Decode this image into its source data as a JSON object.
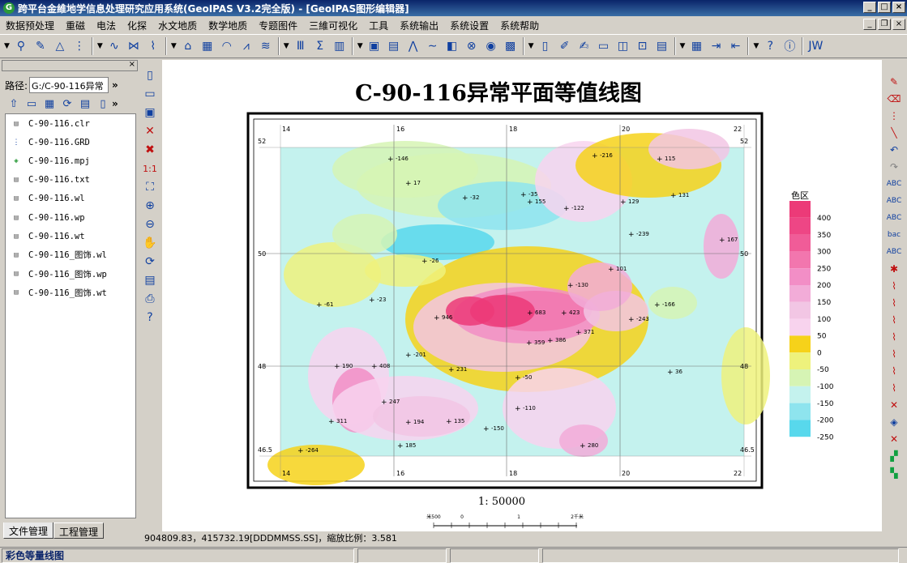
{
  "window": {
    "title": "跨平台金維地学信息处理研究应用系统(GeoIPAS V3.2完全版) - [GeoIPAS图形编辑器]"
  },
  "menu": [
    "数据预处理",
    "重磁",
    "电法",
    "化探",
    "水文地质",
    "数学地质",
    "专题图件",
    "三維可视化",
    "工具",
    "系统输出",
    "系统设置",
    "系统帮助"
  ],
  "left_panel": {
    "path_label": "路径:",
    "path_value": "G:/C-90-116异常",
    "files": [
      {
        "name": "C-90-116.clr",
        "icon": "doc-icon"
      },
      {
        "name": "C-90-116.GRD",
        "icon": "grid-icon"
      },
      {
        "name": "C-90-116.mpj",
        "icon": "layers-icon"
      },
      {
        "name": "C-90-116.txt",
        "icon": "doc-icon"
      },
      {
        "name": "C-90-116.wl",
        "icon": "doc-icon"
      },
      {
        "name": "C-90-116.wp",
        "icon": "doc-icon"
      },
      {
        "name": "C-90-116.wt",
        "icon": "doc-icon"
      },
      {
        "name": "C-90-116_图饰.wl",
        "icon": "doc-icon"
      },
      {
        "name": "C-90-116_图饰.wp",
        "icon": "doc-icon"
      },
      {
        "name": "C-90-116_图饰.wt",
        "icon": "doc-icon"
      }
    ],
    "tabs": [
      "文件管理",
      "工程管理"
    ]
  },
  "map": {
    "title": "C-90-116异常平面等值线图",
    "scale": "1: 50000",
    "scalebar_labels": [
      "米500",
      "0",
      "1",
      "2千米"
    ],
    "legend_title": "色区",
    "legend": [
      {
        "label": "400",
        "color": "#ec3a78"
      },
      {
        "label": "350",
        "color": "#ee4685"
      },
      {
        "label": "300",
        "color": "#f05c98"
      },
      {
        "label": "250",
        "color": "#f276ae"
      },
      {
        "label": "200",
        "color": "#f28ec6"
      },
      {
        "label": "150",
        "color": "#f2acd8"
      },
      {
        "label": "100",
        "color": "#f2c6e4"
      },
      {
        "label": "50",
        "color": "#f8d3ee"
      },
      {
        "label": "0",
        "color": "#f6d21a"
      },
      {
        "label": "-50",
        "color": "#eef27c"
      },
      {
        "label": "-100",
        "color": "#d6f4b4"
      },
      {
        "label": "-150",
        "color": "#c4f2ee"
      },
      {
        "label": "-200",
        "color": "#8ee4ee"
      },
      {
        "label": "-250",
        "color": "#58d8ec"
      }
    ],
    "top_ticks": [
      "14",
      "16",
      "18",
      "20",
      "22"
    ],
    "side_ticks": [
      "52",
      "50",
      "48",
      "46.5"
    ],
    "annotations": [
      "-146",
      "17",
      "-216",
      "-32",
      "-35",
      "-122",
      "129",
      "-239",
      "167",
      "-26",
      "-61",
      "-23",
      "-130",
      "-166",
      "946",
      "683",
      "423",
      "-243",
      "371",
      "-201",
      "359",
      "386",
      "231",
      "190",
      "408",
      "-50",
      "36",
      "247",
      "-110",
      "194",
      "135",
      "-150",
      "311",
      "185",
      "280",
      "-264",
      "155",
      "115",
      "131",
      "101"
    ]
  },
  "status": {
    "coords": "904809.83，415732.19[DDDMMSS.SS]，縮放比例：3.581",
    "mode": "彩色等量线图"
  }
}
